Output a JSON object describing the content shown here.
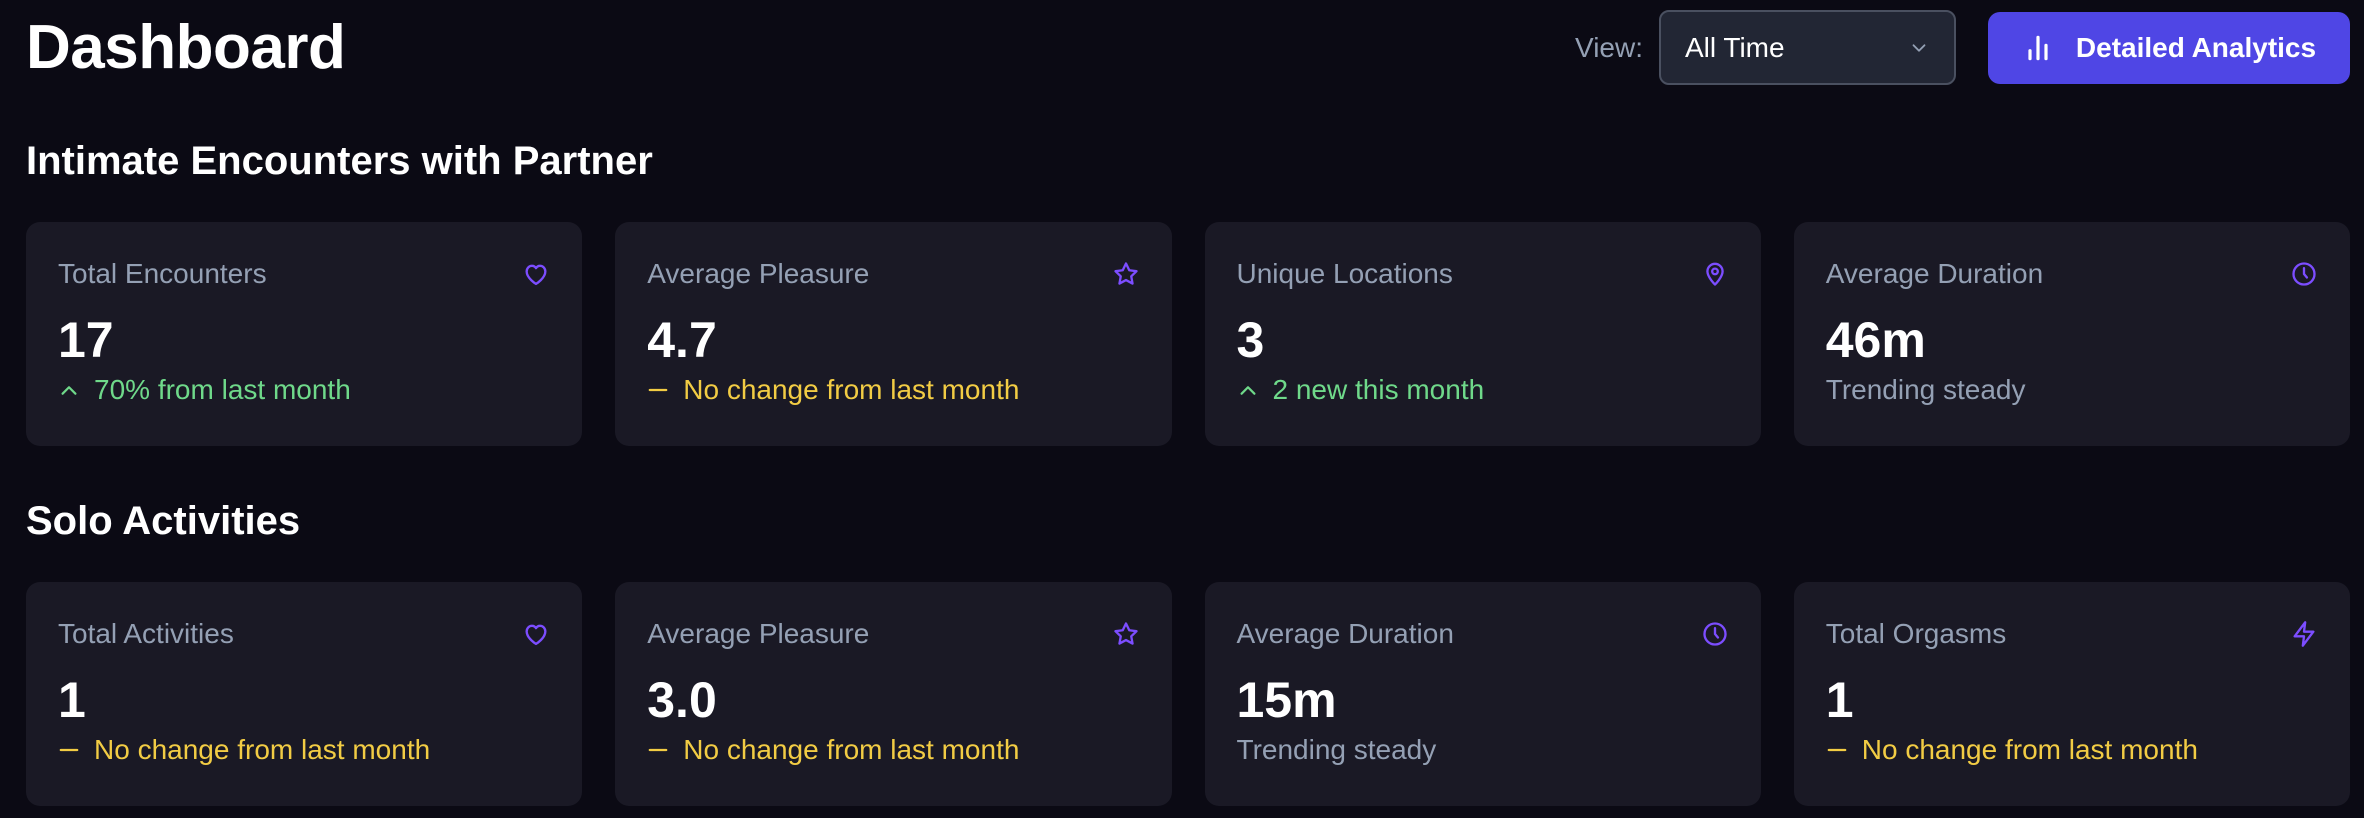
{
  "header": {
    "title": "Dashboard",
    "view_label": "View:",
    "view_select": {
      "value": "All Time"
    },
    "analytics_button": {
      "label": "Detailed Analytics",
      "icon": "bar-chart-icon"
    }
  },
  "colors": {
    "background": "#0b0a14",
    "card": "#1a1925",
    "accent": "#4f46e5",
    "icon": "#7c4dff",
    "trend_up": "#6fd98a",
    "trend_flat": "#f2cc44",
    "muted": "#94a0b4"
  },
  "sections": [
    {
      "title": "Intimate Encounters with Partner",
      "cards": [
        {
          "label": "Total Encounters",
          "icon": "heart-icon",
          "value": "17",
          "trend": "70% from last month",
          "trend_type": "up"
        },
        {
          "label": "Average Pleasure",
          "icon": "star-icon",
          "value": "4.7",
          "trend": "No change from last month",
          "trend_type": "flat"
        },
        {
          "label": "Unique Locations",
          "icon": "map-pin-icon",
          "value": "3",
          "trend": "2 new this month",
          "trend_type": "up"
        },
        {
          "label": "Average Duration",
          "icon": "clock-icon",
          "value": "46m",
          "trend": "Trending steady",
          "trend_type": "steady"
        }
      ]
    },
    {
      "title": "Solo Activities",
      "cards": [
        {
          "label": "Total Activities",
          "icon": "heart-icon",
          "value": "1",
          "trend": "No change from last month",
          "trend_type": "flat"
        },
        {
          "label": "Average Pleasure",
          "icon": "star-icon",
          "value": "3.0",
          "trend": "No change from last month",
          "trend_type": "flat"
        },
        {
          "label": "Average Duration",
          "icon": "clock-icon",
          "value": "15m",
          "trend": "Trending steady",
          "trend_type": "steady"
        },
        {
          "label": "Total Orgasms",
          "icon": "zap-icon",
          "value": "1",
          "trend": "No change from last month",
          "trend_type": "flat"
        }
      ]
    }
  ]
}
